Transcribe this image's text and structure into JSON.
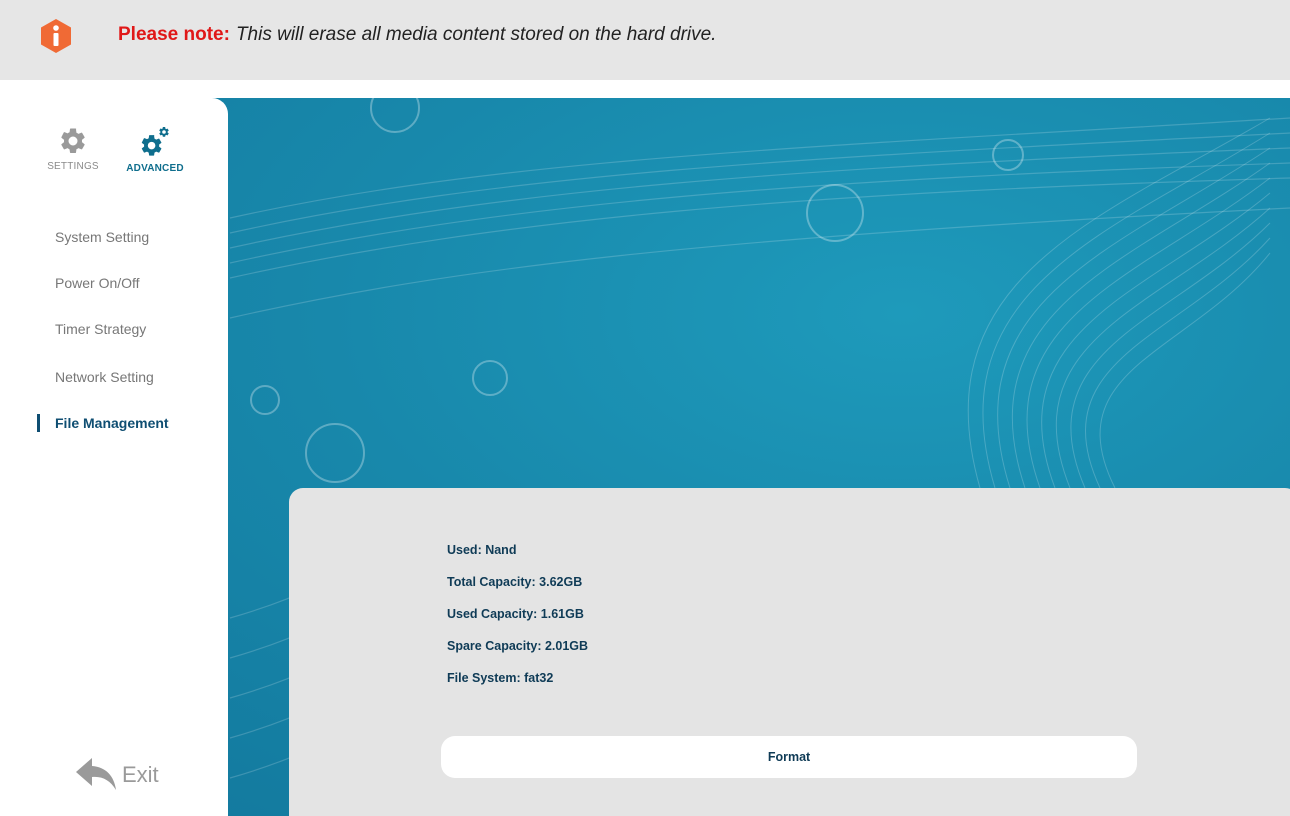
{
  "note": {
    "icon": "info-icon",
    "icon_color": "#f06a35",
    "label": "Please note:",
    "message": "This will erase all media content stored on the hard drive."
  },
  "tabs": [
    {
      "label": "SETTINGS",
      "icon": "gear-icon",
      "active": false
    },
    {
      "label": "ADVANCED",
      "icon": "gears-icon",
      "active": true
    }
  ],
  "menu": [
    {
      "label": "System Setting",
      "active": false
    },
    {
      "label": "Power On/Off",
      "active": false
    },
    {
      "label": "Timer Strategy",
      "active": false
    },
    {
      "label": "Network Setting",
      "active": false
    },
    {
      "label": "File Management",
      "active": true
    }
  ],
  "exit": {
    "label": "Exit",
    "icon": "back-arrow-icon"
  },
  "storage": {
    "used": "Used: Nand",
    "total": "Total Capacity: 3.62GB",
    "used_capacity": "Used Capacity: 1.61GB",
    "spare": "Spare Capacity: 2.01GB",
    "file_system": "File System: fat32"
  },
  "format_button": "Format",
  "colors": {
    "accent": "#0f6e8d",
    "active_text": "#0f4e72",
    "background": "#1a8eb0",
    "warning_label": "#e01818"
  }
}
